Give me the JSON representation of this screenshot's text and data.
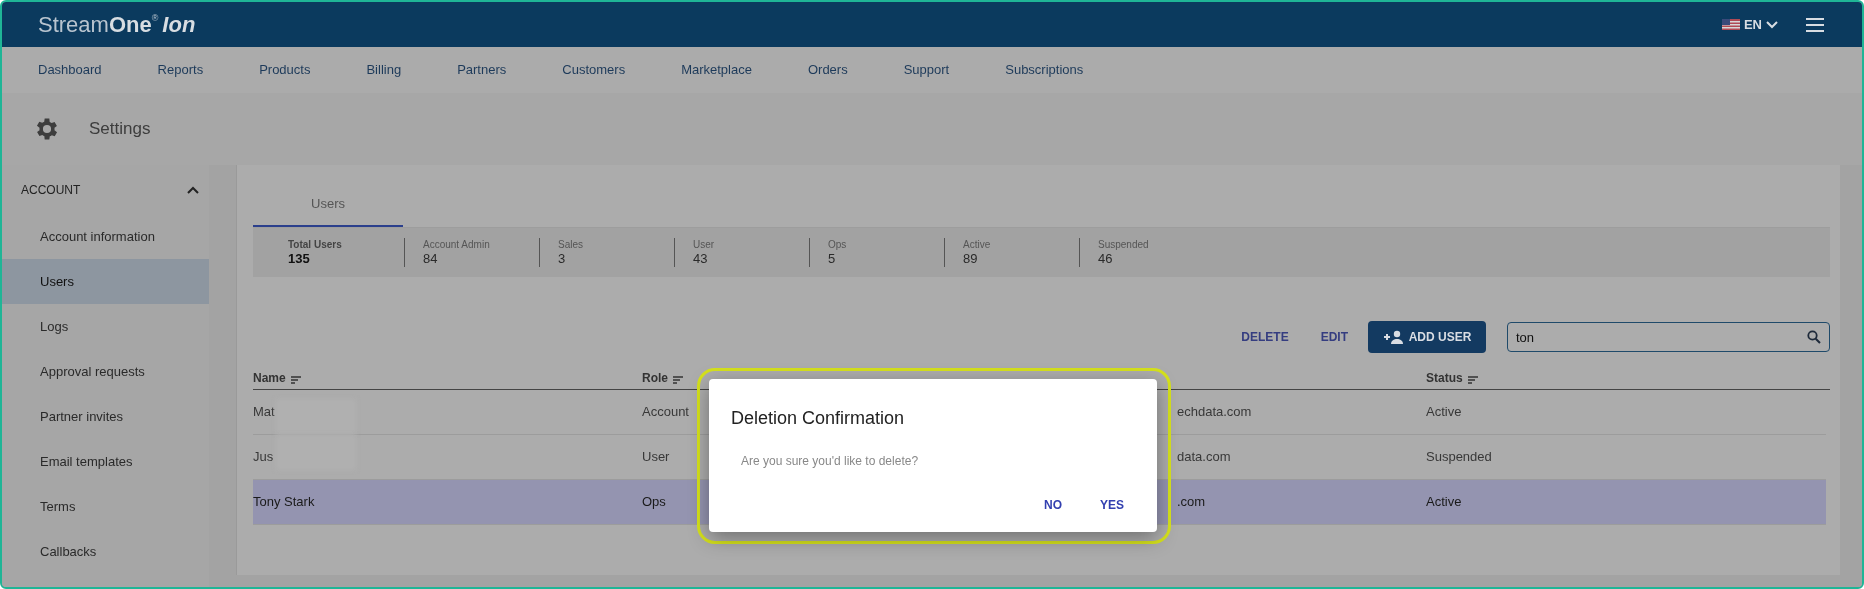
{
  "header": {
    "logo": {
      "part1": "Stream",
      "part2": "One",
      "mark": "®",
      "part3": "Ion"
    },
    "language": "EN"
  },
  "nav": [
    {
      "label": "Dashboard"
    },
    {
      "label": "Reports"
    },
    {
      "label": "Products"
    },
    {
      "label": "Billing"
    },
    {
      "label": "Partners"
    },
    {
      "label": "Customers"
    },
    {
      "label": "Marketplace"
    },
    {
      "label": "Orders"
    },
    {
      "label": "Support"
    },
    {
      "label": "Subscriptions"
    }
  ],
  "page_title": "Settings",
  "sidebar": {
    "section": "ACCOUNT",
    "expanded": true,
    "items": [
      {
        "label": "Account information",
        "selected": false
      },
      {
        "label": "Users",
        "selected": true
      },
      {
        "label": "Logs",
        "selected": false
      },
      {
        "label": "Approval requests",
        "selected": false
      },
      {
        "label": "Partner invites",
        "selected": false
      },
      {
        "label": "Email templates",
        "selected": false
      },
      {
        "label": "Terms",
        "selected": false
      },
      {
        "label": "Callbacks",
        "selected": false
      }
    ]
  },
  "tabs": [
    {
      "label": "Users",
      "selected": true
    }
  ],
  "stats": [
    {
      "label": "Total Users",
      "value": "135",
      "selected": true
    },
    {
      "label": "Account Admin",
      "value": "84",
      "selected": false
    },
    {
      "label": "Sales",
      "value": "3",
      "selected": false
    },
    {
      "label": "User",
      "value": "43",
      "selected": false
    },
    {
      "label": "Ops",
      "value": "5",
      "selected": false
    },
    {
      "label": "Active",
      "value": "89",
      "selected": false
    },
    {
      "label": "Suspended",
      "value": "46",
      "selected": false
    }
  ],
  "toolbar": {
    "delete": "DELETE",
    "edit": "EDIT",
    "add": "ADD USER",
    "search": {
      "value": "ton"
    }
  },
  "table": {
    "columns": [
      {
        "label": "Name"
      },
      {
        "label": "Role"
      },
      {
        "label": "Status"
      }
    ],
    "rows": [
      {
        "name": "Mat",
        "redacted": true,
        "role": "Account",
        "column_3": "echdata.com",
        "status": "Active",
        "selected": false
      },
      {
        "name": "Jus",
        "redacted": true,
        "role": "User",
        "column_3": "data.com",
        "status": "Suspended",
        "selected": false
      },
      {
        "name": "Tony Stark",
        "redacted": false,
        "role": "Ops",
        "column_3": ".com",
        "status": "Active",
        "selected": true
      }
    ]
  },
  "dialog": {
    "title": "Deletion Confirmation",
    "message": "Are you sure you'd like to delete?",
    "buttons": [
      "NO",
      "YES"
    ]
  }
}
